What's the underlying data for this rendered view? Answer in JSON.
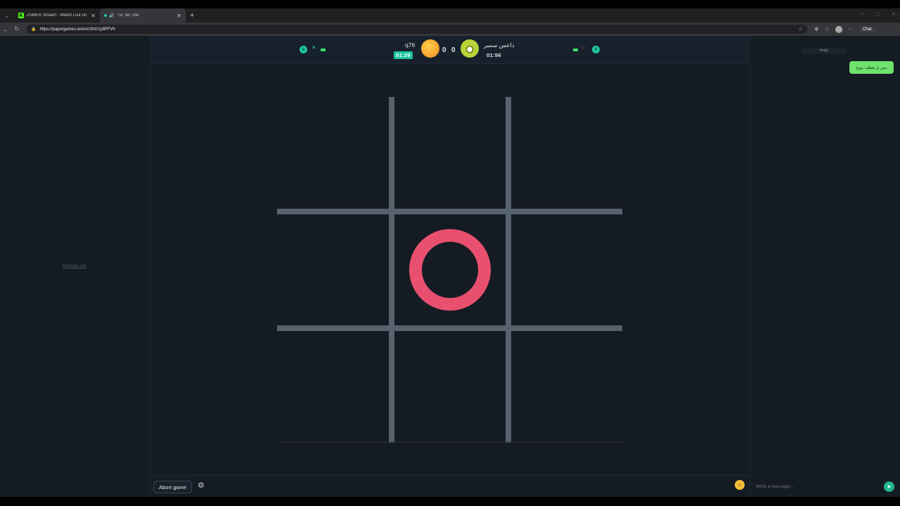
{
  "browser": {
    "tabs": [
      {
        "label": "ZSMER Stream - Watch Live on Ki",
        "favicon": "K"
      },
      {
        "label": "Tic Tac Toe"
      }
    ],
    "url": "https://papergames.io/en/r/2hG1y9PFVh",
    "chat_button": "Chat"
  },
  "left_ad": {
    "remove_ads": "Remove ads"
  },
  "scoreboard": {
    "player1": {
      "name": "q76",
      "timer": "01:39",
      "score": "0",
      "mark": "×",
      "mark_color": "#1ec5a0",
      "badge": "0"
    },
    "player2": {
      "name": "داعس سمير",
      "timer": "01:56",
      "score": "0",
      "mark": "○",
      "mark_color": "#e9506f",
      "badge": "5"
    }
  },
  "board": {
    "cells": [
      "",
      "",
      "",
      "",
      "O",
      "",
      "",
      "",
      ""
    ],
    "o_color": "#e9506f",
    "line_color": "#56636e"
  },
  "footer": {
    "abort_label": "Abort game",
    "settings_icon": "gear-icon"
  },
  "chat": {
    "date_label": "today",
    "messages": [
      {
        "text": "بس ي هطف يبوع",
        "own": true
      }
    ],
    "input_placeholder": "Write a message...",
    "send_icon": "send-icon",
    "emoji_icon": "emoji-icon"
  }
}
